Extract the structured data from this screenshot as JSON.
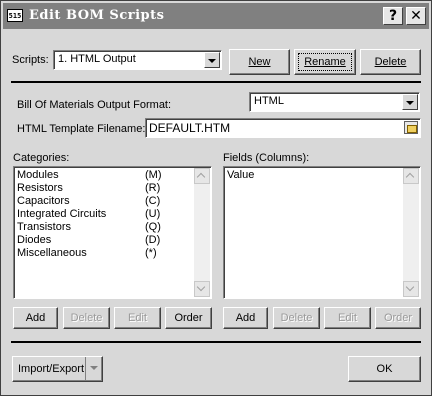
{
  "window": {
    "icon_text": "515",
    "title": "Edit BOM Scripts"
  },
  "title_buttons": {
    "help": "?",
    "close": "✕"
  },
  "scripts": {
    "label": "Scripts:",
    "selected": "1. HTML Output",
    "new_label": "New",
    "rename_label": "Rename",
    "delete_label": "Delete"
  },
  "bom_format": {
    "label": "Bill Of Materials Output Format:",
    "selected": "HTML"
  },
  "template": {
    "label": "HTML Template Filename:",
    "value": "DEFAULT.HTM"
  },
  "categories": {
    "label": "Categories:",
    "items": [
      {
        "name": "Modules",
        "code": "(M)"
      },
      {
        "name": "Resistors",
        "code": "(R)"
      },
      {
        "name": "Capacitors",
        "code": "(C)"
      },
      {
        "name": "Integrated Circuits",
        "code": "(U)"
      },
      {
        "name": "Transistors",
        "code": "(Q)"
      },
      {
        "name": "Diodes",
        "code": "(D)"
      },
      {
        "name": "Miscellaneous",
        "code": "(*)"
      }
    ],
    "add_label": "Add",
    "delete_label": "Delete",
    "edit_label": "Edit",
    "order_label": "Order"
  },
  "fields": {
    "label": "Fields (Columns):",
    "items": [
      "Value"
    ],
    "add_label": "Add",
    "delete_label": "Delete",
    "edit_label": "Edit",
    "order_label": "Order"
  },
  "footer": {
    "import_export_label": "Import/Export",
    "ok_label": "OK"
  }
}
